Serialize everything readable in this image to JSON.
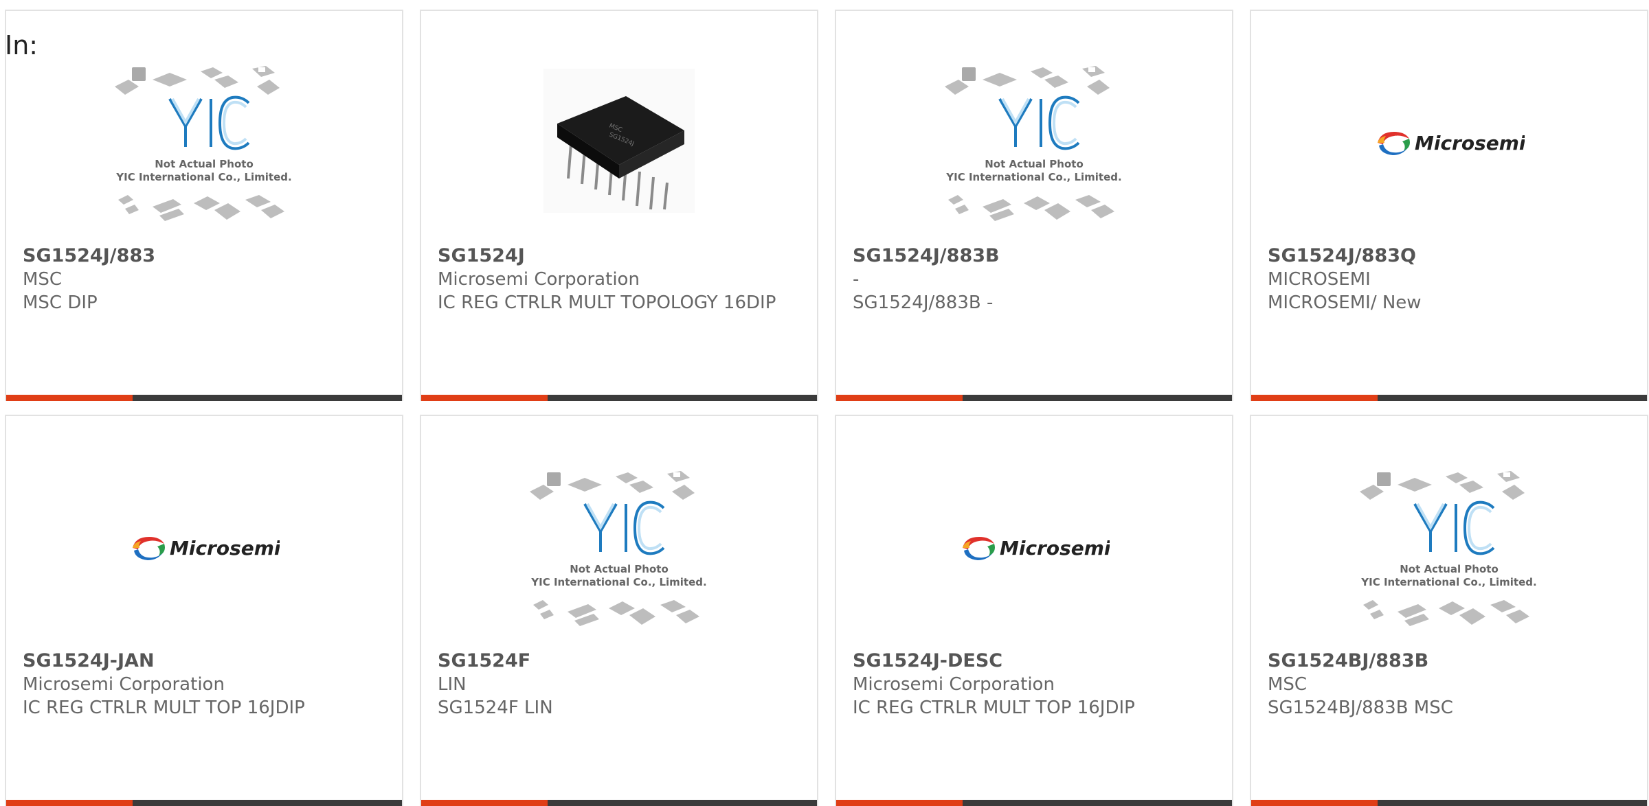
{
  "filter_label": "In:",
  "colors": {
    "accent": "#e03e16",
    "bar": "#3b3b3b",
    "text": "#666666",
    "yic_blue": "#1e7bbf"
  },
  "placeholder_text": {
    "line1": "Not Actual Photo",
    "line2": "YIC International Co., Limited."
  },
  "logo_text": "Microsemi",
  "products": [
    {
      "part": "SG1524J/883",
      "maker": "MSC",
      "desc": "MSC DIP",
      "image": "yic-placeholder"
    },
    {
      "part": "SG1524J",
      "maker": "Microsemi Corporation",
      "desc": "IC REG CTRLR MULT TOPOLOGY 16DIP",
      "image": "dip-chip-photo"
    },
    {
      "part": "SG1524J/883B",
      "maker": "-",
      "desc": "SG1524J/883B -",
      "image": "yic-placeholder"
    },
    {
      "part": "SG1524J/883Q",
      "maker": "MICROSEMI",
      "desc": "MICROSEMI/ New",
      "image": "microsemi-logo"
    },
    {
      "part": "SG1524J-JAN",
      "maker": "Microsemi Corporation",
      "desc": "IC REG CTRLR MULT TOP 16JDIP",
      "image": "microsemi-logo"
    },
    {
      "part": "SG1524F",
      "maker": "LIN",
      "desc": "SG1524F LIN",
      "image": "yic-placeholder"
    },
    {
      "part": "SG1524J-DESC",
      "maker": "Microsemi Corporation",
      "desc": "IC REG CTRLR MULT TOP 16JDIP",
      "image": "microsemi-logo"
    },
    {
      "part": "SG1524BJ/883B",
      "maker": "MSC",
      "desc": "SG1524BJ/883B MSC",
      "image": "yic-placeholder"
    }
  ]
}
